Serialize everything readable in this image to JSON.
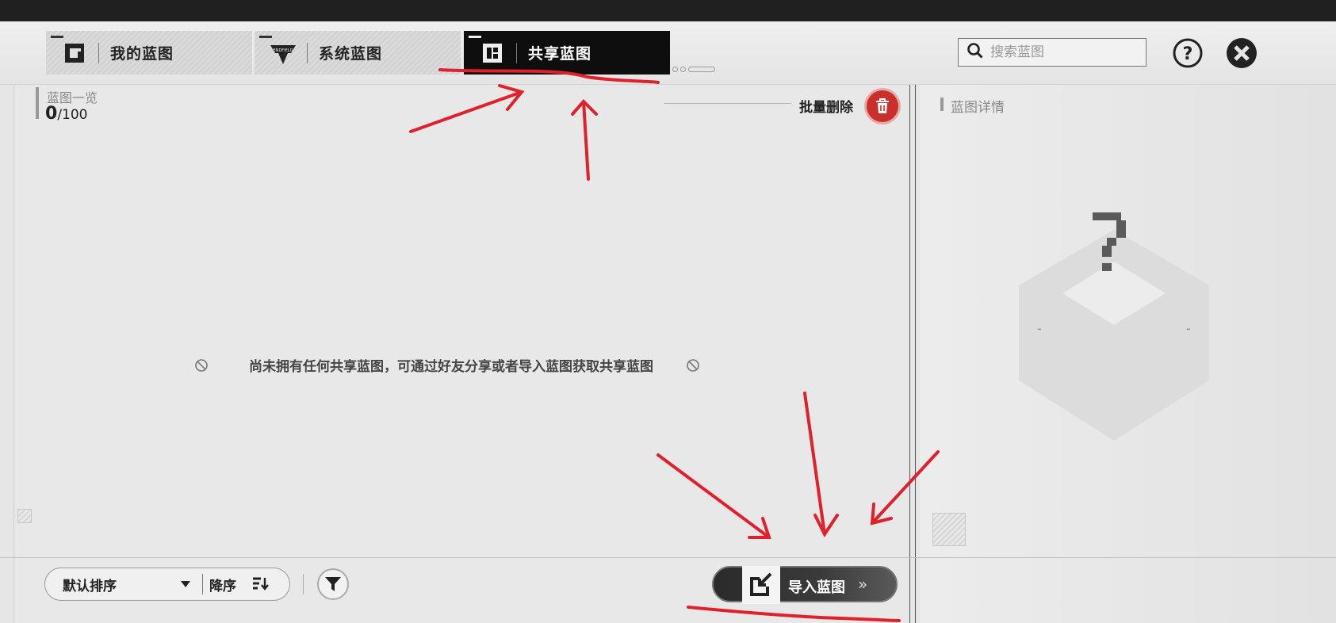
{
  "tabs": [
    {
      "label": "我的蓝图",
      "icon": "my-blueprint-icon"
    },
    {
      "label": "系统蓝图",
      "icon": "endfield-logo-icon",
      "logo_text": "ENDFIELD"
    },
    {
      "label": "共享蓝图",
      "icon": "shared-blueprint-icon",
      "active": true
    }
  ],
  "search": {
    "placeholder": "搜索蓝图"
  },
  "list": {
    "title": "蓝图一览",
    "count": "0",
    "max": "/100",
    "batch_delete_label": "批量删除",
    "empty_message": "尚未拥有任何共享蓝图，可通过好友分享或者导入蓝图获取共享蓝图"
  },
  "detail": {
    "title": "蓝图详情",
    "placeholder_left": "-",
    "placeholder_right": "-"
  },
  "sort": {
    "default_label": "默认排序",
    "order_label": "降序"
  },
  "import": {
    "label": "导入蓝图",
    "chevron": "»"
  },
  "colors": {
    "accent_red": "#c9302b",
    "annotation_red": "#e0202a",
    "active_tab": "#0e0e0e"
  }
}
